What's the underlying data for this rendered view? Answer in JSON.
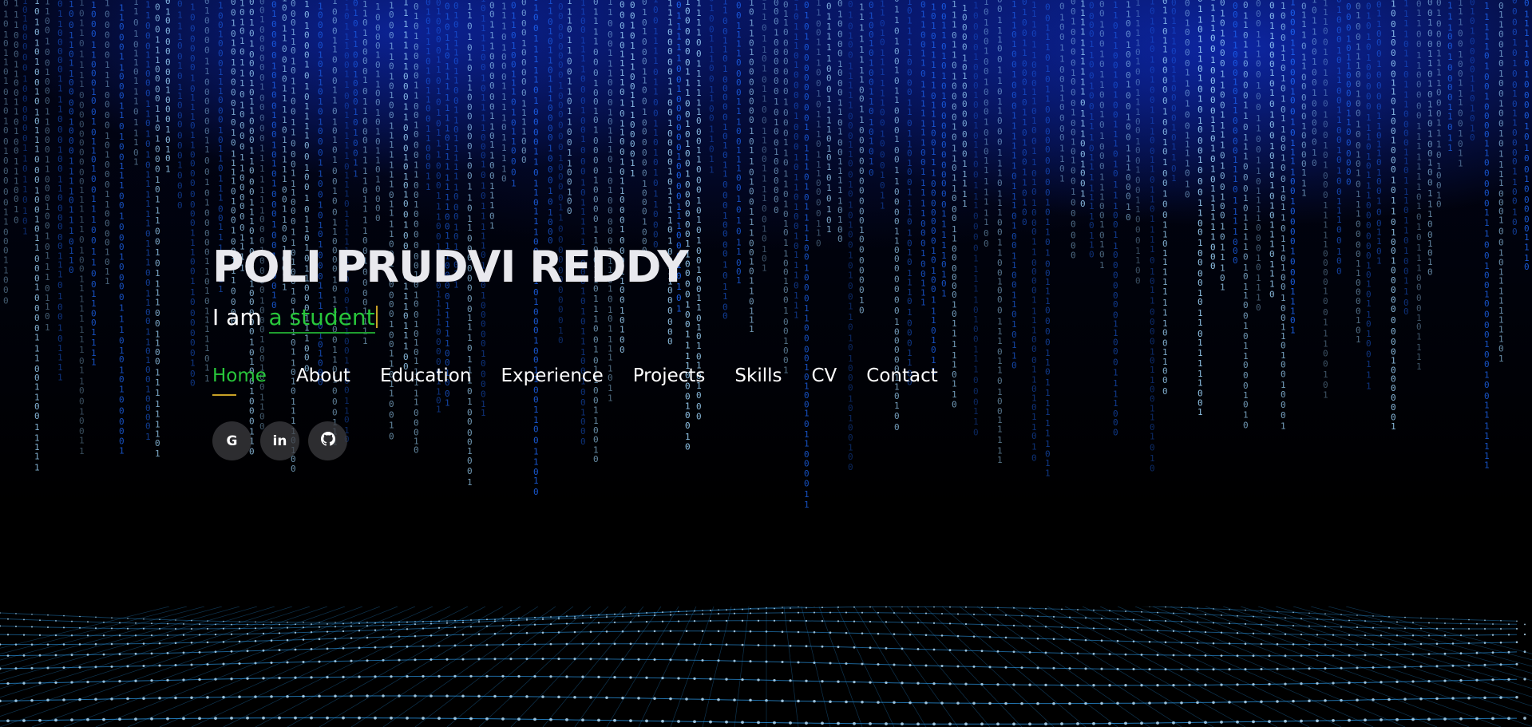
{
  "hero": {
    "name": "POLI PRUDVI REDDY",
    "tagline_prefix": "I am",
    "tagline_typed": "a student"
  },
  "nav": [
    {
      "label": "Home",
      "active": true
    },
    {
      "label": "About"
    },
    {
      "label": "Education"
    },
    {
      "label": "Experience"
    },
    {
      "label": "Projects"
    },
    {
      "label": "Skills"
    },
    {
      "label": "CV"
    },
    {
      "label": "Contact"
    }
  ],
  "socials": [
    {
      "icon": "google-icon",
      "glyph": "G"
    },
    {
      "icon": "linkedin-icon",
      "glyph": "in"
    },
    {
      "icon": "github-icon",
      "glyph": ""
    }
  ],
  "colors": {
    "accent": "#28c73b",
    "underline": "#c9a227",
    "rain": "#1e6bff",
    "rain_bright": "#9fd8ff",
    "grid": "#2fa8ff",
    "social_bg": "#3c3c40"
  },
  "background": {
    "rain_glyphs": [
      "0",
      "1"
    ]
  }
}
